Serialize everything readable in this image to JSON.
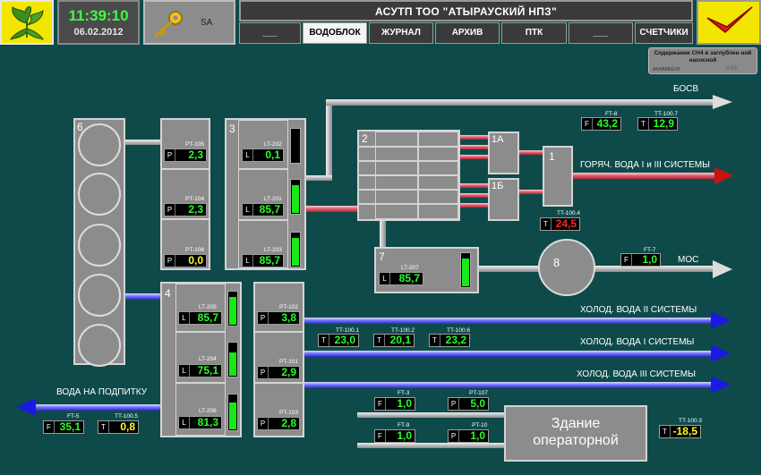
{
  "header": {
    "time": "11:39:10",
    "date": "06.02.2012",
    "user": "SA",
    "title": "АСУТП ТОО \"АТЫРАУСКИЙ НПЗ\"",
    "tabs": [
      "___",
      "ВОДОБЛОК",
      "ЖУРНАЛ",
      "АРХИВ",
      "ПТК",
      "___",
      "СЧЕТЧИКИ"
    ],
    "active_tab": "ВОДОБЛОК"
  },
  "ch4_panel": {
    "title": "Содержание CH4 в заглублен ной насосной",
    "id": "AKHAMKEVII",
    "value": "0.00"
  },
  "units": {
    "u1": "1",
    "u1a": "1А",
    "u1b": "1Б",
    "u2": "2",
    "u3": "3",
    "u4": "4",
    "u6": "6",
    "u7": "7",
    "u8": "8"
  },
  "lines": {
    "bosv": "БОСВ",
    "hot_water": "ГОРЯЧ. ВОДА I и III СИСТЕМЫ",
    "mos": "МОС",
    "cold2": "ХОЛОД. ВОДА II СИСТЕМЫ",
    "cold1": "ХОЛОД. ВОДА I СИСТЕМЫ",
    "cold3": "ХОЛОД. ВОДА III СИСТЕМЫ",
    "makeup": "ВОДА НА ПОДПИТКУ"
  },
  "building": {
    "line1": "Здание",
    "line2": "операторной"
  },
  "readouts": {
    "pt105": {
      "tag": "PT-105",
      "type": "P",
      "value": "2,3"
    },
    "pt104": {
      "tag": "PT-104",
      "type": "P",
      "value": "2,3"
    },
    "pt108": {
      "tag": "PT-108",
      "type": "P",
      "value": "0,0"
    },
    "lt202": {
      "tag": "LT-202",
      "type": "L",
      "value": "0,1"
    },
    "lt201": {
      "tag": "LT-201",
      "type": "L",
      "value": "85,7"
    },
    "lt203": {
      "tag": "LT-203",
      "type": "L",
      "value": "85,7"
    },
    "lt207": {
      "tag": "LT-207",
      "type": "L",
      "value": "85,7"
    },
    "lt205": {
      "tag": "LT-205",
      "type": "L",
      "value": "85,7"
    },
    "lt204": {
      "tag": "LT-204",
      "type": "L",
      "value": "75,1"
    },
    "lt206": {
      "tag": "LT-206",
      "type": "L",
      "value": "81,3"
    },
    "pt102": {
      "tag": "PT-102",
      "type": "P",
      "value": "3,8"
    },
    "pt101": {
      "tag": "PT-101",
      "type": "P",
      "value": "2,9"
    },
    "pt103": {
      "tag": "PT-103",
      "type": "P",
      "value": "2,8"
    },
    "ft8a": {
      "tag": "FT-8",
      "type": "F",
      "value": "43,2"
    },
    "tt1007": {
      "tag": "TT-100.7",
      "type": "T",
      "value": "12,9"
    },
    "tt1004": {
      "tag": "TT-100.4",
      "type": "T",
      "value": "24,5"
    },
    "ft7": {
      "tag": "FT-7",
      "type": "F",
      "value": "1,0"
    },
    "tt1001": {
      "tag": "TT-100.1",
      "type": "T",
      "value": "23,0"
    },
    "tt1002": {
      "tag": "TT-100.2",
      "type": "T",
      "value": "20,1"
    },
    "tt1006": {
      "tag": "TT-100.6",
      "type": "T",
      "value": "23,2"
    },
    "ft5": {
      "tag": "FT-5",
      "type": "F",
      "value": "35,1"
    },
    "tt1005": {
      "tag": "TT-100.5",
      "type": "T",
      "value": "0,8"
    },
    "ft3": {
      "tag": "FT-3",
      "type": "F",
      "value": "1,0"
    },
    "pt107": {
      "tag": "PT-107",
      "type": "P",
      "value": "5,0"
    },
    "ft9": {
      "tag": "FT-9",
      "type": "F",
      "value": "1,0"
    },
    "pt10": {
      "tag": "PT-10",
      "type": "P",
      "value": "1,0"
    },
    "tt1003": {
      "tag": "TT-100.3",
      "type": "T",
      "value": "-18,5"
    }
  },
  "levels": {
    "lt202": 0.0,
    "lt201": 0.86,
    "lt203": 0.86,
    "lt207": 0.86,
    "lt205": 0.86,
    "lt204": 0.75,
    "lt206": 0.81
  },
  "colors": {
    "background": "#0f4a4a",
    "equipment": "#8c8c8c",
    "value_normal": "#28ff28",
    "value_warn": "#ffff2a",
    "value_alarm": "#ff2626",
    "hot_line": "#e05a6a",
    "cold_line": "#5a5aff",
    "arrow_hot": "#cc1111",
    "arrow_cold": "#1a1ae0"
  }
}
